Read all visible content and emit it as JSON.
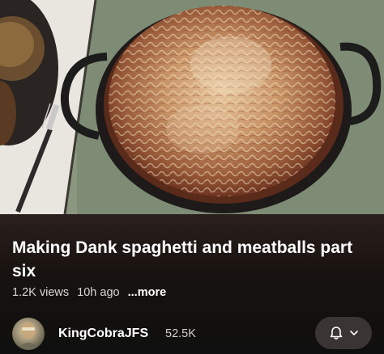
{
  "video": {
    "title": "Making Dank spaghetti and meatballs part six",
    "views": "1.2K views",
    "age": "10h ago",
    "more_label": "...more"
  },
  "channel": {
    "name": "KingCobraJFS",
    "subscribers": "52.5K"
  },
  "icons": {
    "avatar": "channel-avatar",
    "notify": "bell-icon",
    "dropdown": "chevron-down-icon"
  },
  "colors": {
    "background": "#0f0f0f",
    "text": "#ffffff",
    "secondary_text": "#d7d7d7",
    "button_bg": "#3a3533"
  }
}
